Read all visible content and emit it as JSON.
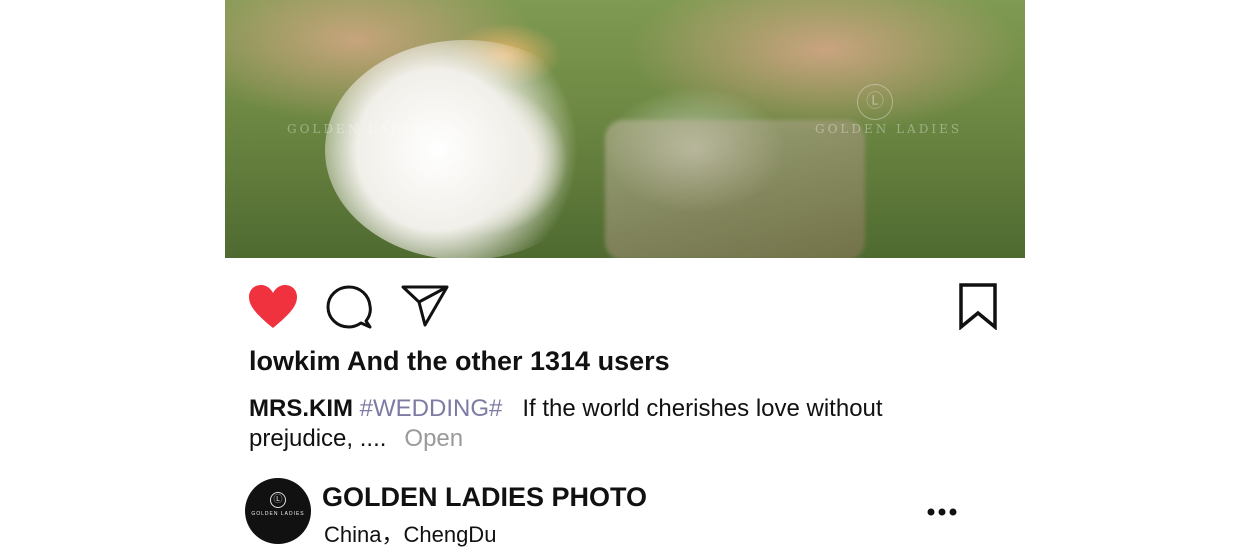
{
  "post": {
    "watermark_text": "GOLDEN LADIES",
    "watermark_logo": "Ⓛ",
    "likes_text": "lowkim And the other 1314 users",
    "caption": {
      "author": "MRS.KIM",
      "hashtag": "#WEDDING#",
      "text": "If the world cherishes love without prejudice, ....",
      "more_label": "Open"
    },
    "account": {
      "name": "GOLDEN LADIES PHOTO",
      "location": "China，ChengDu",
      "avatar_logo": "Ⓛ",
      "avatar_text": "GOLDEN LADIES"
    }
  },
  "icons": {
    "like": "heart-icon",
    "comment": "comment-icon",
    "share": "share-icon",
    "save": "bookmark-icon",
    "more": "more-icon"
  },
  "colors": {
    "like_active": "#f0323f",
    "hashtag": "#7d7aa3",
    "muted": "#9a9a9a",
    "text": "#111111"
  }
}
